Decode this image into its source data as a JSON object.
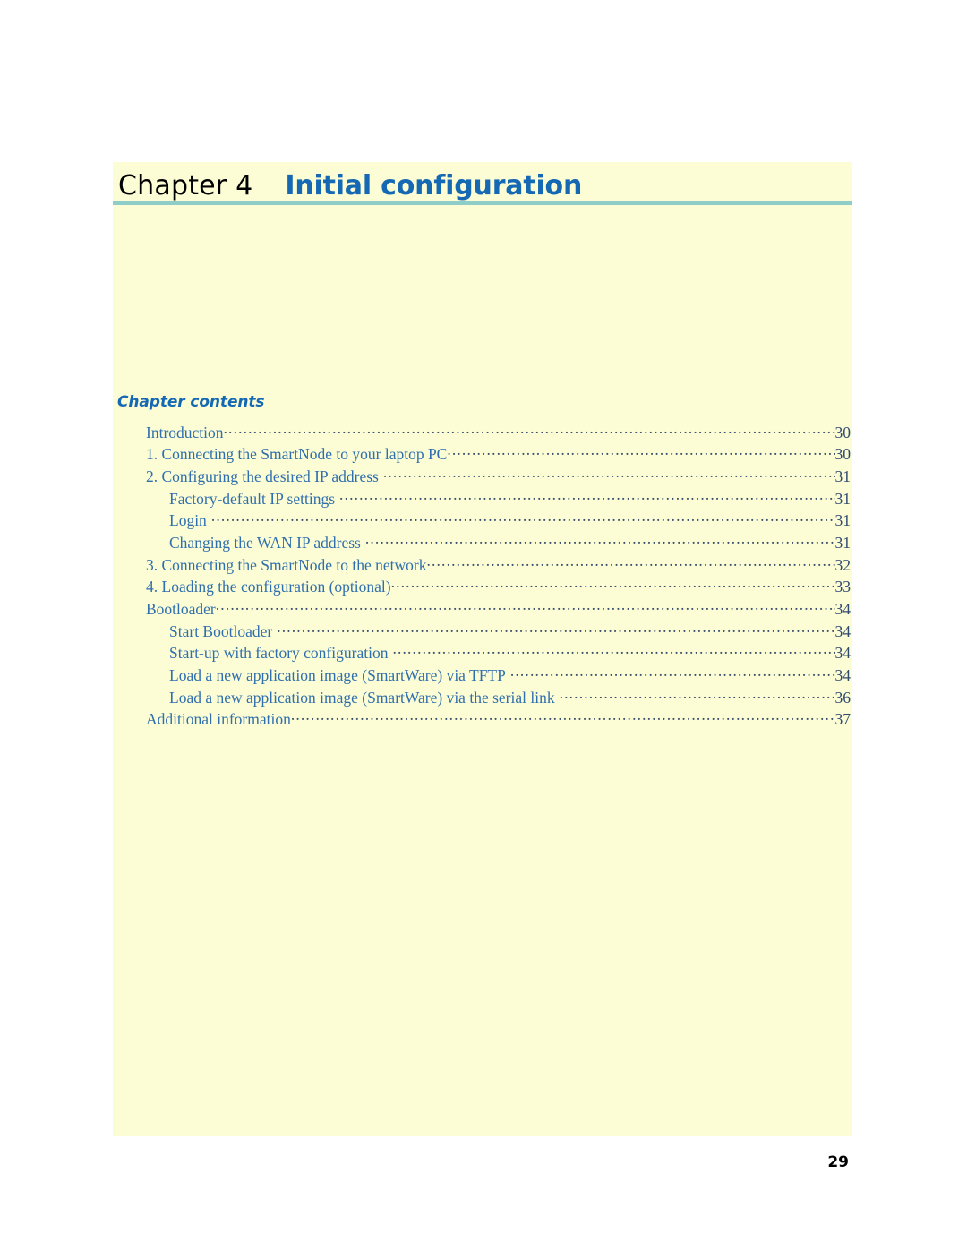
{
  "page": {
    "chapter_label": "Chapter 4",
    "chapter_title": "Initial configuration",
    "contents_heading": "Chapter contents",
    "footer_page_number": "29",
    "accent_blue": "#1569b4",
    "toc_blue": "#2f6fae",
    "panel_yellow": "#fcfdd4",
    "rule_teal": "#8fcdc8"
  },
  "toc": {
    "entries": [
      {
        "label": "Introduction",
        "page": "30",
        "level": 1,
        "tight": true
      },
      {
        "label": "1. Connecting the SmartNode to your laptop PC",
        "page": "30",
        "level": 1,
        "tight": true
      },
      {
        "label": "2. Configuring the desired IP address",
        "page": "31",
        "level": 1,
        "tight": false
      },
      {
        "label": "Factory-default IP settings",
        "page": "31",
        "level": 2,
        "tight": false
      },
      {
        "label": "Login",
        "page": "31",
        "level": 2,
        "tight": false
      },
      {
        "label": "Changing the WAN IP address",
        "page": "31",
        "level": 2,
        "tight": false
      },
      {
        "label": "3. Connecting the SmartNode to the network",
        "page": "32",
        "level": 1,
        "tight": true
      },
      {
        "label": "4. Loading the configuration (optional)",
        "page": "33",
        "level": 1,
        "tight": true
      },
      {
        "label": "Bootloader",
        "page": "34",
        "level": 1,
        "tight": true
      },
      {
        "label": "Start Bootloader",
        "page": "34",
        "level": 2,
        "tight": false
      },
      {
        "label": "Start-up with factory configuration",
        "page": "34",
        "level": 2,
        "tight": false
      },
      {
        "label": "Load a new application image (SmartWare) via TFTP",
        "page": "34",
        "level": 2,
        "tight": false
      },
      {
        "label": "Load a new application image (SmartWare) via the serial link",
        "page": "36",
        "level": 2,
        "tight": false
      },
      {
        "label": "Additional information",
        "page": "37",
        "level": 1,
        "tight": true
      }
    ]
  }
}
